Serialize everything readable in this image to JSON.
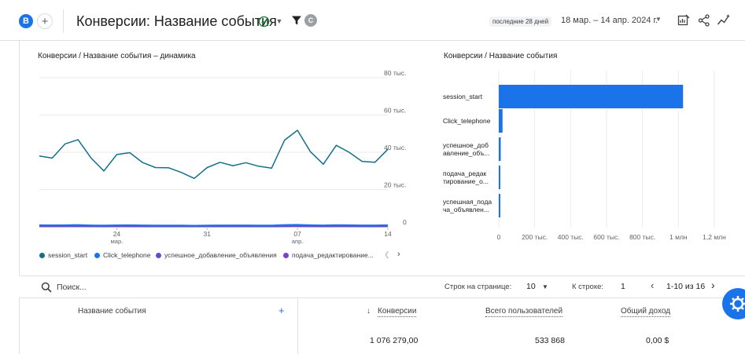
{
  "header": {
    "avatar_letter": "B",
    "add_label": "+",
    "title": "Конверсии: Название события",
    "filter_chip": "C",
    "date_chip": "последние 28 дней",
    "date_range": "18 мар. – 14 апр. 2024 г."
  },
  "line_card": {
    "title": "Конверсии / Название события – динамика",
    "y_ticks": [
      "80 тыс.",
      "60 тыс.",
      "40 тыс.",
      "20 тыс.",
      "0"
    ],
    "x_ticks": [
      {
        "day": "24",
        "month": "мар."
      },
      {
        "day": "31",
        "month": ""
      },
      {
        "day": "07",
        "month": "апр."
      },
      {
        "day": "14",
        "month": ""
      }
    ],
    "legend": [
      {
        "label": "session_start",
        "color": "#12708b"
      },
      {
        "label": "Click_telephone",
        "color": "#1a73e8"
      },
      {
        "label": "успешное_добавление_объявления",
        "color": "#5b4fd6"
      },
      {
        "label": "подача_редактирование...",
        "color": "#7c3fd3"
      }
    ]
  },
  "bar_card": {
    "title": "Конверсии / Название события",
    "x_ticks": [
      "0",
      "200 тыс.",
      "400 тыс.",
      "600 тыс.",
      "800 тыс.",
      "1 млн",
      "1,2 млн"
    ],
    "categories": [
      [
        "session_start"
      ],
      [
        "Click_telephone"
      ],
      [
        "успешное_доб",
        "авление_объ..."
      ],
      [
        "подача_редак",
        "тирование_о..."
      ],
      [
        "успешная_пода",
        "ча_объявлен..."
      ]
    ]
  },
  "chart_data": [
    {
      "type": "line",
      "title": "Конверсии / Название события – динамика",
      "x_start": "2024-03-18",
      "x_end": "2024-04-14",
      "ylim": [
        0,
        80000
      ],
      "series": [
        {
          "name": "session_start",
          "values": [
            38000,
            36900,
            44500,
            46800,
            37000,
            30000,
            38800,
            39800,
            34500,
            31800,
            31700,
            29200,
            26000,
            31800,
            34600,
            32800,
            34400,
            32500,
            31500,
            46500,
            51800,
            40300,
            33600,
            43700,
            40000,
            35100,
            34600,
            41600
          ]
        },
        {
          "name": "Click_telephone",
          "values": [
            900,
            850,
            900,
            1000,
            800,
            700,
            850,
            900,
            800,
            750,
            750,
            700,
            650,
            750,
            800,
            800,
            800,
            750,
            750,
            1000,
            1100,
            900,
            800,
            950,
            900,
            800,
            800,
            900
          ]
        },
        {
          "name": "успешное_добавление_объявления",
          "values": [
            400,
            380,
            420,
            430,
            380,
            350,
            390,
            400,
            370,
            350,
            350,
            340,
            320,
            350,
            370,
            360,
            370,
            350,
            350,
            420,
            450,
            400,
            370,
            410,
            400,
            370,
            370,
            400
          ]
        },
        {
          "name": "подача_редактирование...",
          "values": [
            250,
            240,
            260,
            270,
            240,
            220,
            250,
            250,
            230,
            220,
            220,
            210,
            200,
            220,
            230,
            230,
            230,
            220,
            220,
            260,
            280,
            250,
            230,
            260,
            250,
            230,
            230,
            250
          ]
        }
      ]
    },
    {
      "type": "bar",
      "orientation": "horizontal",
      "title": "Конверсии / Название события",
      "categories": [
        "session_start",
        "Click_telephone",
        "успешное_добавление_объ...",
        "подача_редактирование_о...",
        "успешная_подача_объявлен..."
      ],
      "values": [
        1026000,
        21000,
        11000,
        6000,
        3000
      ],
      "xlim": [
        0,
        1200000
      ]
    }
  ],
  "table": {
    "search_placeholder": "Поиск...",
    "rows_per_page_label": "Строк на странице:",
    "rows_per_page_value": "10",
    "to_row_label": "К строке:",
    "to_row_value": "1",
    "pagination": "1-10 из 16",
    "columns": {
      "event_name": "Название события",
      "conversions": "Конверсии",
      "total_users": "Всего пользователей",
      "total_revenue": "Общий доход"
    },
    "sort_arrow": "↓",
    "add_col": "+",
    "totals": {
      "conversions": "1 076 279,00",
      "total_users": "533 868",
      "total_revenue": "0,00 $"
    }
  }
}
